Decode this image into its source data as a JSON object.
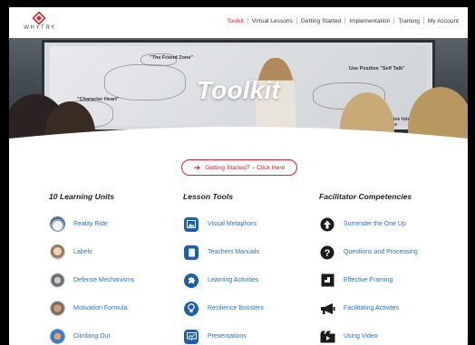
{
  "brand": {
    "logo_text": "WHYTRY",
    "accent": "#d4232f"
  },
  "nav": {
    "items": [
      {
        "label": "Toolkit",
        "active": true
      },
      {
        "label": "Virtual Lessons"
      },
      {
        "label": "Getting Started"
      },
      {
        "label": "Implementation"
      },
      {
        "label": "Training"
      },
      {
        "label": "My Account"
      }
    ]
  },
  "hero": {
    "title": "Toolkit",
    "board_texts": [
      "\"The Friend Zone\"",
      "\"Character Heart\"",
      "Use Positive \"Self Talk\"",
      "A Positive Internal Dialogue"
    ]
  },
  "cta": {
    "label": "Getting Started? – Click Here"
  },
  "columns": {
    "units": {
      "title": "10 Learning Units",
      "items": [
        {
          "label": "Reality Ride",
          "icon": "reality-ride-icon"
        },
        {
          "label": "Labels",
          "icon": "labels-icon"
        },
        {
          "label": "Defense Mechanisms",
          "icon": "defense-mechanisms-icon"
        },
        {
          "label": "Motivation Formula",
          "icon": "motivation-formula-icon"
        },
        {
          "label": "Climbing Out",
          "icon": "climbing-out-icon"
        }
      ]
    },
    "tools": {
      "title": "Lesson Tools",
      "items": [
        {
          "label": "Visual Metaphors",
          "icon": "picture-icon"
        },
        {
          "label": "Teachers Manuals",
          "icon": "book-icon"
        },
        {
          "label": "Learning Activities",
          "icon": "puzzle-icon"
        },
        {
          "label": "Resilience Boosters",
          "icon": "lightbulb-icon"
        },
        {
          "label": "Presentations",
          "icon": "presentation-icon"
        }
      ]
    },
    "competencies": {
      "title": "Facilitator Competencies",
      "items": [
        {
          "label": "Surrender the One Up",
          "icon": "arrow-up-circle-icon"
        },
        {
          "label": "Questions and Processing",
          "icon": "question-circle-icon"
        },
        {
          "label": "Effective Framing",
          "icon": "frame-icon"
        },
        {
          "label": "Facilitating Activites",
          "icon": "megaphone-icon"
        },
        {
          "label": "Using Video",
          "icon": "video-icon"
        }
      ]
    }
  }
}
